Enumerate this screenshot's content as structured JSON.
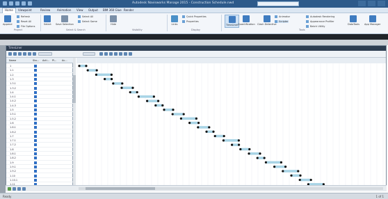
{
  "window": {
    "title": "Autodesk Navisworks Manage 2015 - Construction Schedule.nwd"
  },
  "ribbon": {
    "tabs": [
      "Home",
      "Viewpoint",
      "Review",
      "Animation",
      "View",
      "Output",
      "BIM 360 Glue",
      "Render"
    ],
    "active_tab": "Home",
    "buttons": [
      {
        "label": "Append",
        "color": "#3f7cc0"
      },
      {
        "label": "Refresh",
        "color": "#5a9a4a"
      },
      {
        "label": "Select",
        "color": "#3f7cc0"
      },
      {
        "label": "Save Selection",
        "color": "#7a8fa8"
      },
      {
        "label": "Hide",
        "color": "#7a8fa8"
      },
      {
        "label": "Links",
        "color": "#4a90c8"
      },
      {
        "label": "TimeLiner",
        "color": "#3f7cc0"
      },
      {
        "label": "Quantification",
        "color": "#3f7cc0"
      },
      {
        "label": "Clash Detective",
        "color": "#3f7cc0"
      },
      {
        "label": "DataTools",
        "color": "#3f7cc0"
      },
      {
        "label": "App Manager",
        "color": "#3f7cc0"
      }
    ],
    "small_items": [
      "Reset All",
      "File Options",
      "Select All",
      "Select Same",
      "Quick Properties",
      "Properties",
      "Animator",
      "Scripter",
      "Autodesk Rendering",
      "Appearance Profiler",
      "Batch Utility",
      "Compare"
    ],
    "groups": [
      "Project",
      "Select & Search",
      "Visibility",
      "Display",
      "Tools"
    ]
  },
  "panel": {
    "title": "TimeLiner",
    "columns": [
      "Name",
      "Sta...",
      "Acti...",
      "Pl...",
      "Ac..."
    ],
    "rows": [
      "1",
      "1.1",
      "1.2",
      "1.3",
      "1.3.1",
      "1.3.2",
      "1.4",
      "1.4.1",
      "1.4.2",
      "1.4.3",
      "1.5",
      "1.5.1",
      "1.5.2",
      "1.6",
      "1.6.1",
      "1.6.2",
      "1.7",
      "1.7.1",
      "1.7.2",
      "1.8",
      "1.8.1",
      "1.8.2",
      "1.9",
      "1.9.1",
      "1.9.2",
      "1.10",
      "1.10.1",
      "1.11"
    ]
  },
  "status_bar": {
    "left": "Ready",
    "right": "1 of 1"
  },
  "colors": {
    "accent": "#2d5a8a",
    "bar": "#a8d4e6",
    "milestone": "#111111"
  }
}
